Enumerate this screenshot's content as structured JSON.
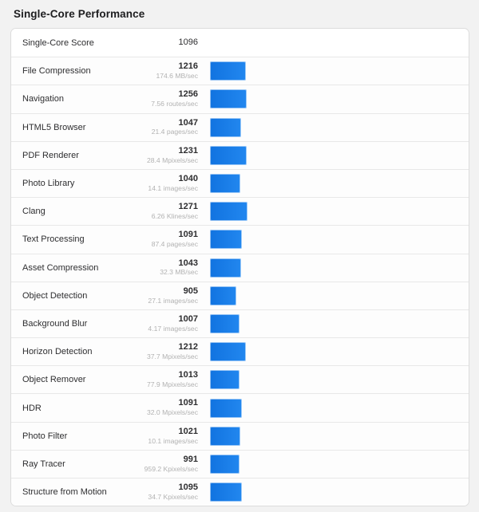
{
  "page": {
    "title": "Single-Core Performance",
    "accent_color": "#1a7ee8",
    "background_color": "#f2f2f2"
  },
  "chart_data": {
    "type": "bar",
    "title": "Single-Core Performance",
    "xlabel": "",
    "ylabel": "",
    "orientation": "horizontal",
    "bar_scale_max": 1271,
    "summary": {
      "label": "Single-Core Score",
      "score": 1096
    },
    "categories": [
      "File Compression",
      "Navigation",
      "HTML5 Browser",
      "PDF Renderer",
      "Photo Library",
      "Clang",
      "Text Processing",
      "Asset Compression",
      "Object Detection",
      "Background Blur",
      "Horizon Detection",
      "Object Remover",
      "HDR",
      "Photo Filter",
      "Ray Tracer",
      "Structure from Motion"
    ],
    "values": [
      1216,
      1256,
      1047,
      1231,
      1040,
      1271,
      1091,
      1043,
      905,
      1007,
      1212,
      1013,
      1091,
      1021,
      991,
      1095
    ],
    "rates": [
      "174.6 MB/sec",
      "7.56 routes/sec",
      "21.4 pages/sec",
      "28.4 Mpixels/sec",
      "14.1 images/sec",
      "6.26 Klines/sec",
      "87.4 pages/sec",
      "32.3 MB/sec",
      "27.1 images/sec",
      "4.17 images/sec",
      "37.7 Mpixels/sec",
      "77.9 Mpixels/sec",
      "32.0 Mpixels/sec",
      "10.1 images/sec",
      "959.2 Kpixels/sec",
      "34.7 Kpixels/sec"
    ]
  },
  "rows": [
    {
      "name": "Single-Core Score",
      "score": "1096",
      "rate": "",
      "bar": false
    },
    {
      "name": "File Compression",
      "score": "1216",
      "rate": "174.6 MB/sec",
      "bar": true
    },
    {
      "name": "Navigation",
      "score": "1256",
      "rate": "7.56 routes/sec",
      "bar": true
    },
    {
      "name": "HTML5 Browser",
      "score": "1047",
      "rate": "21.4 pages/sec",
      "bar": true
    },
    {
      "name": "PDF Renderer",
      "score": "1231",
      "rate": "28.4 Mpixels/sec",
      "bar": true
    },
    {
      "name": "Photo Library",
      "score": "1040",
      "rate": "14.1 images/sec",
      "bar": true
    },
    {
      "name": "Clang",
      "score": "1271",
      "rate": "6.26 Klines/sec",
      "bar": true
    },
    {
      "name": "Text Processing",
      "score": "1091",
      "rate": "87.4 pages/sec",
      "bar": true
    },
    {
      "name": "Asset Compression",
      "score": "1043",
      "rate": "32.3 MB/sec",
      "bar": true
    },
    {
      "name": "Object Detection",
      "score": "905",
      "rate": "27.1 images/sec",
      "bar": true
    },
    {
      "name": "Background Blur",
      "score": "1007",
      "rate": "4.17 images/sec",
      "bar": true
    },
    {
      "name": "Horizon Detection",
      "score": "1212",
      "rate": "37.7 Mpixels/sec",
      "bar": true
    },
    {
      "name": "Object Remover",
      "score": "1013",
      "rate": "77.9 Mpixels/sec",
      "bar": true
    },
    {
      "name": "HDR",
      "score": "1091",
      "rate": "32.0 Mpixels/sec",
      "bar": true
    },
    {
      "name": "Photo Filter",
      "score": "1021",
      "rate": "10.1 images/sec",
      "bar": true
    },
    {
      "name": "Ray Tracer",
      "score": "991",
      "rate": "959.2 Kpixels/sec",
      "bar": true
    },
    {
      "name": "Structure from Motion",
      "score": "1095",
      "rate": "34.7 Kpixels/sec",
      "bar": true
    }
  ]
}
